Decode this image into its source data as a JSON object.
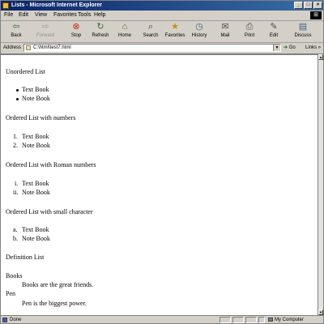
{
  "window": {
    "title": "Lists - Microsoft Internet Explorer",
    "controls": {
      "minimize": "_",
      "maximize": "□",
      "close": "×"
    }
  },
  "menu": [
    "File",
    "Edit",
    "View",
    "Favorites",
    "Tools",
    "Help"
  ],
  "toolbar": {
    "back": "Back",
    "forward": "Forward",
    "stop": "Stop",
    "refresh": "Refresh",
    "home": "Home",
    "search": "Search",
    "favorites": "Favorites",
    "history": "History",
    "mail": "Mail",
    "print": "Print",
    "edit": "Edit",
    "discuss": "Discuss"
  },
  "address": {
    "label": "Address",
    "value": "C:\\html\\test7.html",
    "go": "Go",
    "links": "Links"
  },
  "content": {
    "unordered": {
      "heading": "Unordered List",
      "items": [
        "Text Book",
        "Note Book"
      ]
    },
    "numbers": {
      "heading": "Ordered List with numbers",
      "markers": [
        "1.",
        "2."
      ],
      "items": [
        "Text Book",
        "Note Book"
      ]
    },
    "roman": {
      "heading": "Ordered List with Roman numbers",
      "markers": [
        "i.",
        "ii."
      ],
      "items": [
        "Text Book",
        "Note Book"
      ]
    },
    "small": {
      "heading": "Ordered List with small character",
      "markers": [
        "a.",
        "b."
      ],
      "items": [
        "Text Book",
        "Note Book"
      ]
    },
    "definition": {
      "heading": "Definition List",
      "terms": [
        {
          "term": "Books",
          "desc": "Books are the great friends."
        },
        {
          "term": "Pen",
          "desc": "Pen is the biggest power."
        }
      ]
    }
  },
  "status": {
    "text": "Done",
    "zone": "My Computer"
  },
  "icons": [
    "back-icon",
    "forward-icon",
    "stop-icon",
    "refresh-icon",
    "home-icon",
    "search-icon",
    "favorites-icon",
    "history-icon",
    "mail-icon",
    "print-icon",
    "edit-icon",
    "discuss-icon"
  ]
}
